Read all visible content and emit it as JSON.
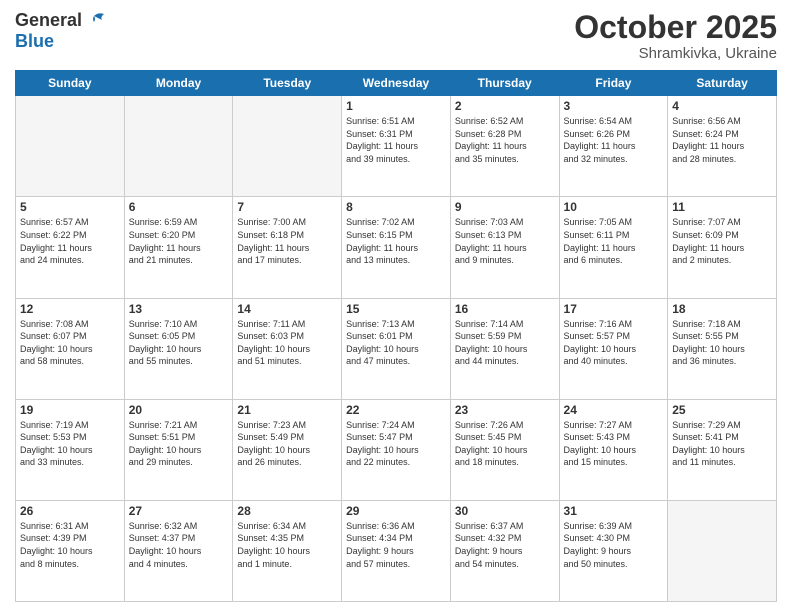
{
  "header": {
    "logo_line1": "General",
    "logo_line2": "Blue",
    "title": "October 2025",
    "subtitle": "Shramkivka, Ukraine"
  },
  "days_of_week": [
    "Sunday",
    "Monday",
    "Tuesday",
    "Wednesday",
    "Thursday",
    "Friday",
    "Saturday"
  ],
  "weeks": [
    [
      {
        "num": "",
        "info": ""
      },
      {
        "num": "",
        "info": ""
      },
      {
        "num": "",
        "info": ""
      },
      {
        "num": "1",
        "info": "Sunrise: 6:51 AM\nSunset: 6:31 PM\nDaylight: 11 hours\nand 39 minutes."
      },
      {
        "num": "2",
        "info": "Sunrise: 6:52 AM\nSunset: 6:28 PM\nDaylight: 11 hours\nand 35 minutes."
      },
      {
        "num": "3",
        "info": "Sunrise: 6:54 AM\nSunset: 6:26 PM\nDaylight: 11 hours\nand 32 minutes."
      },
      {
        "num": "4",
        "info": "Sunrise: 6:56 AM\nSunset: 6:24 PM\nDaylight: 11 hours\nand 28 minutes."
      }
    ],
    [
      {
        "num": "5",
        "info": "Sunrise: 6:57 AM\nSunset: 6:22 PM\nDaylight: 11 hours\nand 24 minutes."
      },
      {
        "num": "6",
        "info": "Sunrise: 6:59 AM\nSunset: 6:20 PM\nDaylight: 11 hours\nand 21 minutes."
      },
      {
        "num": "7",
        "info": "Sunrise: 7:00 AM\nSunset: 6:18 PM\nDaylight: 11 hours\nand 17 minutes."
      },
      {
        "num": "8",
        "info": "Sunrise: 7:02 AM\nSunset: 6:15 PM\nDaylight: 11 hours\nand 13 minutes."
      },
      {
        "num": "9",
        "info": "Sunrise: 7:03 AM\nSunset: 6:13 PM\nDaylight: 11 hours\nand 9 minutes."
      },
      {
        "num": "10",
        "info": "Sunrise: 7:05 AM\nSunset: 6:11 PM\nDaylight: 11 hours\nand 6 minutes."
      },
      {
        "num": "11",
        "info": "Sunrise: 7:07 AM\nSunset: 6:09 PM\nDaylight: 11 hours\nand 2 minutes."
      }
    ],
    [
      {
        "num": "12",
        "info": "Sunrise: 7:08 AM\nSunset: 6:07 PM\nDaylight: 10 hours\nand 58 minutes."
      },
      {
        "num": "13",
        "info": "Sunrise: 7:10 AM\nSunset: 6:05 PM\nDaylight: 10 hours\nand 55 minutes."
      },
      {
        "num": "14",
        "info": "Sunrise: 7:11 AM\nSunset: 6:03 PM\nDaylight: 10 hours\nand 51 minutes."
      },
      {
        "num": "15",
        "info": "Sunrise: 7:13 AM\nSunset: 6:01 PM\nDaylight: 10 hours\nand 47 minutes."
      },
      {
        "num": "16",
        "info": "Sunrise: 7:14 AM\nSunset: 5:59 PM\nDaylight: 10 hours\nand 44 minutes."
      },
      {
        "num": "17",
        "info": "Sunrise: 7:16 AM\nSunset: 5:57 PM\nDaylight: 10 hours\nand 40 minutes."
      },
      {
        "num": "18",
        "info": "Sunrise: 7:18 AM\nSunset: 5:55 PM\nDaylight: 10 hours\nand 36 minutes."
      }
    ],
    [
      {
        "num": "19",
        "info": "Sunrise: 7:19 AM\nSunset: 5:53 PM\nDaylight: 10 hours\nand 33 minutes."
      },
      {
        "num": "20",
        "info": "Sunrise: 7:21 AM\nSunset: 5:51 PM\nDaylight: 10 hours\nand 29 minutes."
      },
      {
        "num": "21",
        "info": "Sunrise: 7:23 AM\nSunset: 5:49 PM\nDaylight: 10 hours\nand 26 minutes."
      },
      {
        "num": "22",
        "info": "Sunrise: 7:24 AM\nSunset: 5:47 PM\nDaylight: 10 hours\nand 22 minutes."
      },
      {
        "num": "23",
        "info": "Sunrise: 7:26 AM\nSunset: 5:45 PM\nDaylight: 10 hours\nand 18 minutes."
      },
      {
        "num": "24",
        "info": "Sunrise: 7:27 AM\nSunset: 5:43 PM\nDaylight: 10 hours\nand 15 minutes."
      },
      {
        "num": "25",
        "info": "Sunrise: 7:29 AM\nSunset: 5:41 PM\nDaylight: 10 hours\nand 11 minutes."
      }
    ],
    [
      {
        "num": "26",
        "info": "Sunrise: 6:31 AM\nSunset: 4:39 PM\nDaylight: 10 hours\nand 8 minutes."
      },
      {
        "num": "27",
        "info": "Sunrise: 6:32 AM\nSunset: 4:37 PM\nDaylight: 10 hours\nand 4 minutes."
      },
      {
        "num": "28",
        "info": "Sunrise: 6:34 AM\nSunset: 4:35 PM\nDaylight: 10 hours\nand 1 minute."
      },
      {
        "num": "29",
        "info": "Sunrise: 6:36 AM\nSunset: 4:34 PM\nDaylight: 9 hours\nand 57 minutes."
      },
      {
        "num": "30",
        "info": "Sunrise: 6:37 AM\nSunset: 4:32 PM\nDaylight: 9 hours\nand 54 minutes."
      },
      {
        "num": "31",
        "info": "Sunrise: 6:39 AM\nSunset: 4:30 PM\nDaylight: 9 hours\nand 50 minutes."
      },
      {
        "num": "",
        "info": ""
      }
    ]
  ]
}
